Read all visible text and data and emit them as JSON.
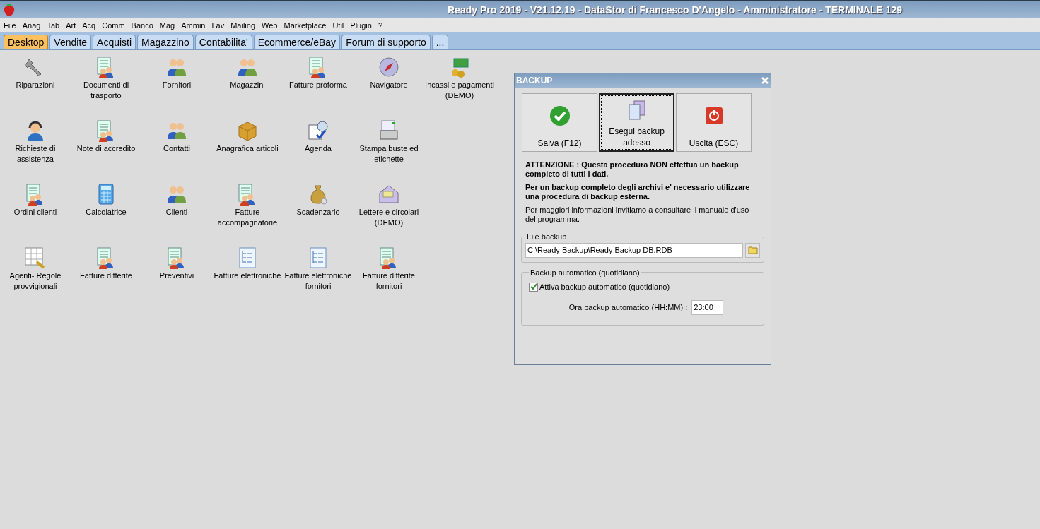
{
  "window": {
    "title": "Ready Pro 2019 - V21.12.19 - DataStor di Francesco D'Angelo - Amministratore - TERMINALE 129"
  },
  "menu": [
    "File",
    "Anag",
    "Tab",
    "Art",
    "Acq",
    "Comm",
    "Banco",
    "Mag",
    "Ammin",
    "Lav",
    "Mailing",
    "Web",
    "Marketplace",
    "Util",
    "Plugin",
    "?"
  ],
  "tabs": [
    {
      "label": "Desktop",
      "selected": true
    },
    {
      "label": "Vendite",
      "selected": false
    },
    {
      "label": "Acquisti",
      "selected": false
    },
    {
      "label": "Magazzino",
      "selected": false
    },
    {
      "label": "Contabilita'",
      "selected": false
    },
    {
      "label": "Ecommerce/eBay",
      "selected": false
    },
    {
      "label": "Forum di supporto",
      "selected": false
    },
    {
      "label": "...",
      "selected": false
    }
  ],
  "desktop_rows": [
    [
      {
        "label": "Riparazioni",
        "kind": "wrench"
      },
      {
        "label": "Documenti di trasporto",
        "kind": "doc-people"
      },
      {
        "label": "Fornitori",
        "kind": "people"
      },
      {
        "label": "Magazzini",
        "kind": "people"
      },
      {
        "label": "Fatture proforma",
        "kind": "doc-people"
      },
      {
        "label": "Navigatore",
        "kind": "compass"
      },
      {
        "label": "Incassi e pagamenti (DEMO)",
        "kind": "money"
      }
    ],
    [
      {
        "label": "Richieste di assistenza",
        "kind": "headset"
      },
      {
        "label": "Note di accredito",
        "kind": "doc-people"
      },
      {
        "label": "Contatti",
        "kind": "people"
      },
      {
        "label": "Anagrafica articoli",
        "kind": "box"
      },
      {
        "label": "Agenda",
        "kind": "calendar"
      },
      {
        "label": "Stampa buste ed etichette",
        "kind": "printer"
      }
    ],
    [
      {
        "label": "Ordini clienti",
        "kind": "doc-people"
      },
      {
        "label": "Calcolatrice",
        "kind": "calculator"
      },
      {
        "label": "Clienti",
        "kind": "people"
      },
      {
        "label": "Fatture accompagnatorie",
        "kind": "doc-people"
      },
      {
        "label": "Scadenzario",
        "kind": "moneybag"
      },
      {
        "label": "Lettere e circolari (DEMO)",
        "kind": "envelope"
      }
    ],
    [
      {
        "label": "Agenti- Regole provvigionali",
        "kind": "grid"
      },
      {
        "label": "Fatture differite",
        "kind": "doc-people"
      },
      {
        "label": "Preventivi",
        "kind": "doc-people"
      },
      {
        "label": "Fatture elettroniche",
        "kind": "tree-doc"
      },
      {
        "label": "Fatture elettroniche fornitori",
        "kind": "tree-doc"
      },
      {
        "label": "Fatture differite fornitori",
        "kind": "doc-people"
      }
    ]
  ],
  "dialog": {
    "title": "BACKUP",
    "buttons": [
      {
        "label": "Salva (F12)",
        "kind": "check",
        "focused": false
      },
      {
        "label": "Esegui backup adesso",
        "kind": "copy",
        "focused": true
      },
      {
        "label": "Uscita (ESC)",
        "kind": "power",
        "focused": false
      }
    ],
    "warning": "ATTENZIONE : Questa procedura NON effettua un backup completo di tutti i dati.",
    "warning_2": "Per un backup completo degli archivi e' necessario utilizzare una procedura di backup esterna.",
    "info": "Per maggiori informazioni invitiamo a consultare il manuale d'uso del programma.",
    "file_group": {
      "legend": "File backup",
      "value": "C:\\Ready Backup\\Ready Backup DB.RDB"
    },
    "auto_group": {
      "legend": "Backup automatico (quotidiano)",
      "checkbox": {
        "label": "Attiva backup automatico (quotidiano)",
        "checked": true
      },
      "time_label": "Ora backup automatico (HH:MM) :",
      "time_value": "23:00"
    }
  }
}
